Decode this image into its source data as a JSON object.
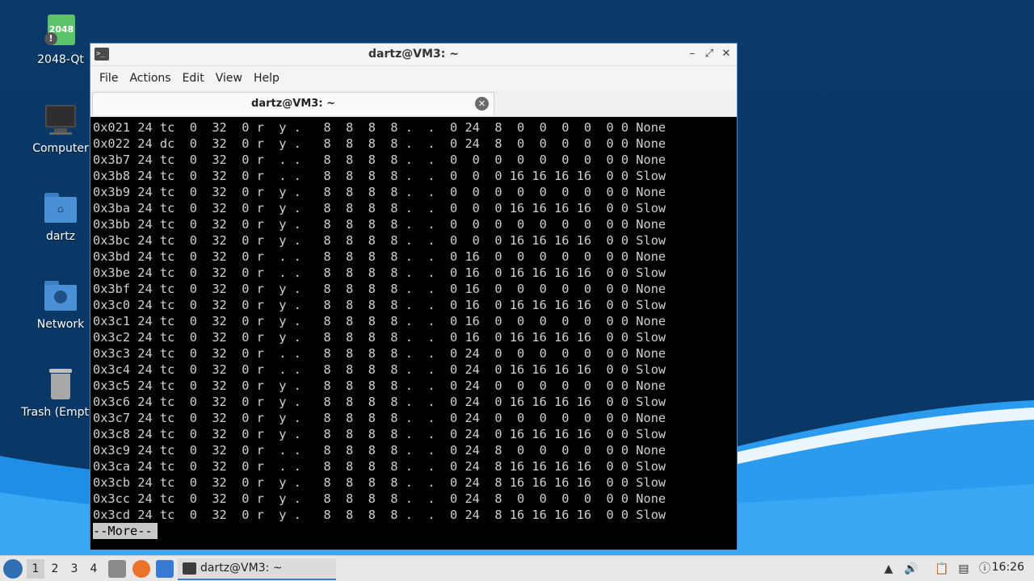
{
  "desktop": {
    "icons": [
      {
        "label": "2048-Qt",
        "badge": "2048"
      },
      {
        "label": "Computer"
      },
      {
        "label": "dartz"
      },
      {
        "label": "Network"
      },
      {
        "label": "Trash (Empty)"
      }
    ]
  },
  "window": {
    "title": "dartz@VM3: ~",
    "menu": [
      "File",
      "Actions",
      "Edit",
      "View",
      "Help"
    ],
    "tab_title": "dartz@VM3: ~",
    "terminal_lines": [
      "0x021 24 tc  0  32  0 r  y .   8  8  8  8 .  .  0 24  8  0  0  0  0  0 0 None",
      "0x022 24 dc  0  32  0 r  y .   8  8  8  8 .  .  0 24  8  0  0  0  0  0 0 None",
      "0x3b7 24 tc  0  32  0 r  . .   8  8  8  8 .  .  0  0  0  0  0  0  0  0 0 None",
      "0x3b8 24 tc  0  32  0 r  . .   8  8  8  8 .  .  0  0  0 16 16 16 16  0 0 Slow",
      "0x3b9 24 tc  0  32  0 r  y .   8  8  8  8 .  .  0  0  0  0  0  0  0  0 0 None",
      "0x3ba 24 tc  0  32  0 r  y .   8  8  8  8 .  .  0  0  0 16 16 16 16  0 0 Slow",
      "0x3bb 24 tc  0  32  0 r  y .   8  8  8  8 .  .  0  0  0  0  0  0  0  0 0 None",
      "0x3bc 24 tc  0  32  0 r  y .   8  8  8  8 .  .  0  0  0 16 16 16 16  0 0 Slow",
      "0x3bd 24 tc  0  32  0 r  . .   8  8  8  8 .  .  0 16  0  0  0  0  0  0 0 None",
      "0x3be 24 tc  0  32  0 r  . .   8  8  8  8 .  .  0 16  0 16 16 16 16  0 0 Slow",
      "0x3bf 24 tc  0  32  0 r  y .   8  8  8  8 .  .  0 16  0  0  0  0  0  0 0 None",
      "0x3c0 24 tc  0  32  0 r  y .   8  8  8  8 .  .  0 16  0 16 16 16 16  0 0 Slow",
      "0x3c1 24 tc  0  32  0 r  y .   8  8  8  8 .  .  0 16  0  0  0  0  0  0 0 None",
      "0x3c2 24 tc  0  32  0 r  y .   8  8  8  8 .  .  0 16  0 16 16 16 16  0 0 Slow",
      "0x3c3 24 tc  0  32  0 r  . .   8  8  8  8 .  .  0 24  0  0  0  0  0  0 0 None",
      "0x3c4 24 tc  0  32  0 r  . .   8  8  8  8 .  .  0 24  0 16 16 16 16  0 0 Slow",
      "0x3c5 24 tc  0  32  0 r  y .   8  8  8  8 .  .  0 24  0  0  0  0  0  0 0 None",
      "0x3c6 24 tc  0  32  0 r  y .   8  8  8  8 .  .  0 24  0 16 16 16 16  0 0 Slow",
      "0x3c7 24 tc  0  32  0 r  y .   8  8  8  8 .  .  0 24  0  0  0  0  0  0 0 None",
      "0x3c8 24 tc  0  32  0 r  y .   8  8  8  8 .  .  0 24  0 16 16 16 16  0 0 Slow",
      "0x3c9 24 tc  0  32  0 r  . .   8  8  8  8 .  .  0 24  8  0  0  0  0  0 0 None",
      "0x3ca 24 tc  0  32  0 r  . .   8  8  8  8 .  .  0 24  8 16 16 16 16  0 0 Slow",
      "0x3cb 24 tc  0  32  0 r  y .   8  8  8  8 .  .  0 24  8 16 16 16 16  0 0 Slow",
      "0x3cc 24 tc  0  32  0 r  y .   8  8  8  8 .  .  0 24  8  0  0  0  0  0 0 None",
      "0x3cd 24 tc  0  32  0 r  y .   8  8  8  8 .  .  0 24  8 16 16 16 16  0 0 Slow"
    ],
    "pager_prompt": "--More--"
  },
  "taskbar": {
    "workspaces": [
      "1",
      "2",
      "3",
      "4"
    ],
    "active_workspace": "1",
    "task_label": "dartz@VM3: ~",
    "clock": "16:26",
    "tray_icons": [
      "up-arrow-icon",
      "volume-icon",
      "clipboard-icon",
      "network-icon",
      "update-icon"
    ]
  }
}
